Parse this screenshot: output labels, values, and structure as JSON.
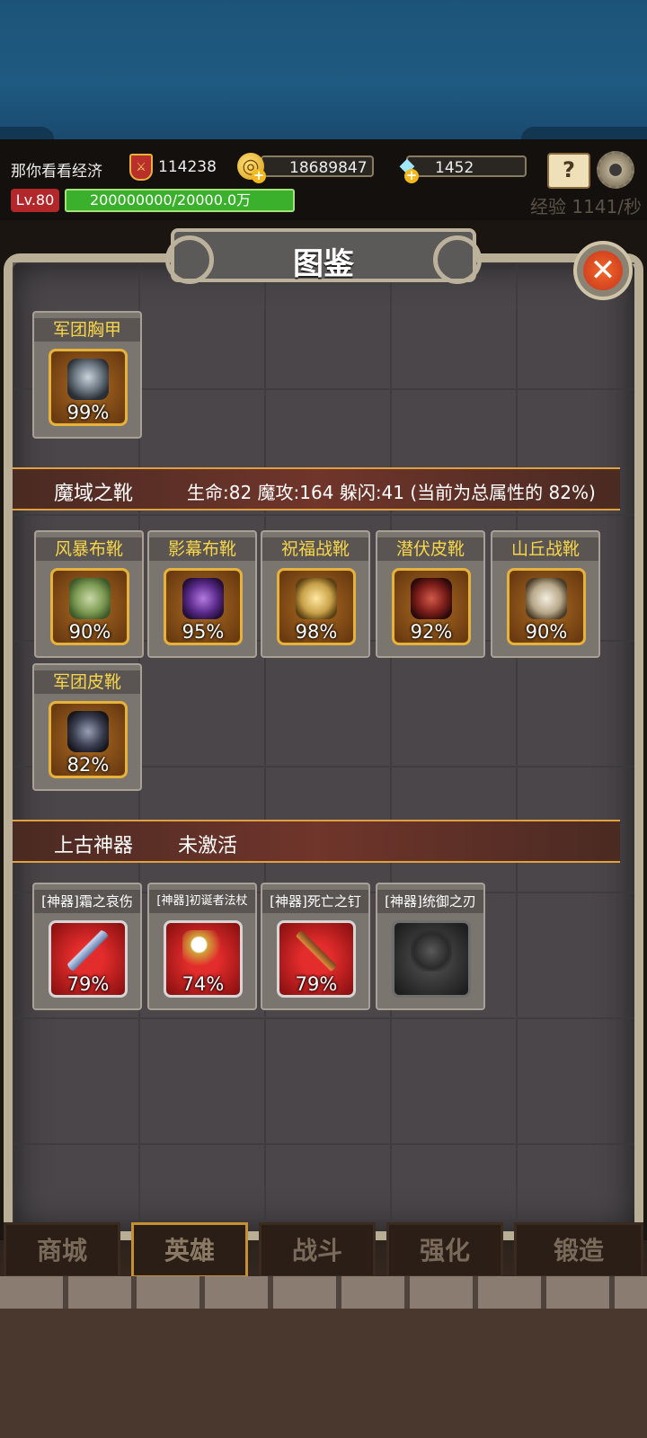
{
  "hud": {
    "player_name": "那你看看经济",
    "power_icon": "shield-sword-icon",
    "power": "114238",
    "gold": "18689847",
    "gems": "1452",
    "level": "Lv.80",
    "exp": "200000000/20000.0万",
    "exp_rate": "经验 1141/秒"
  },
  "panel": {
    "title": "图鉴",
    "close_icon": "close-x-icon"
  },
  "sections": {
    "armor_top": [
      {
        "name": "军团胸甲",
        "percent": "99%",
        "icon": "chest-armor-icon"
      }
    ],
    "boots": {
      "set_name": "魔域之靴",
      "stats": "生命:82 魔攻:164 躲闪:41 (当前为总属性的 82%)",
      "items": [
        {
          "name": "风暴布靴",
          "percent": "90%",
          "icon": "cloth-boots-green-icon"
        },
        {
          "name": "影幕布靴",
          "percent": "95%",
          "icon": "cloth-boots-purple-icon"
        },
        {
          "name": "祝福战靴",
          "percent": "98%",
          "icon": "war-boots-gold-icon"
        },
        {
          "name": "潜伏皮靴",
          "percent": "92%",
          "icon": "leather-boots-red-icon"
        },
        {
          "name": "山丘战靴",
          "percent": "90%",
          "icon": "war-boots-white-icon"
        },
        {
          "name": "军团皮靴",
          "percent": "82%",
          "icon": "leather-boots-dark-icon"
        }
      ]
    },
    "artifacts": {
      "set_name": "上古神器",
      "status": "未激活",
      "items": [
        {
          "name": "[神器]霜之哀伤",
          "percent": "79%",
          "icon": "frost-sword-icon"
        },
        {
          "name": "[神器]初诞者法杖",
          "percent": "74%",
          "icon": "staff-icon"
        },
        {
          "name": "[神器]死亡之钉",
          "percent": "79%",
          "icon": "spike-dagger-icon"
        },
        {
          "name": "[神器]统御之刃",
          "percent": "",
          "icon": "locked-blade-icon"
        }
      ]
    }
  },
  "nav": {
    "tabs": [
      "商城",
      "英雄",
      "战斗",
      "强化",
      "锻造"
    ],
    "active": "英雄"
  }
}
